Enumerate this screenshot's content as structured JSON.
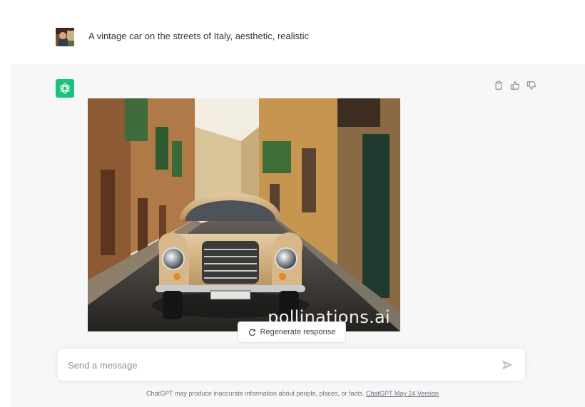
{
  "user_message": {
    "text": "A vintage car on the streets of Italy, aesthetic, realistic"
  },
  "assistant": {
    "image": {
      "description_icon": "vintage-car-italy-image",
      "watermark": "pollinations.ai"
    },
    "actions": [
      "copy-icon",
      "thumbs-up-icon",
      "thumbs-down-icon"
    ]
  },
  "regenerate": {
    "label": "Regenerate response"
  },
  "composer": {
    "placeholder": "Send a message"
  },
  "footer": {
    "text": "ChatGPT may produce inaccurate information about people, places, or facts. ",
    "link_label": "ChatGPT May 24 Version"
  },
  "colors": {
    "accent": "#19c37d",
    "panel": "#f7f7f8"
  }
}
